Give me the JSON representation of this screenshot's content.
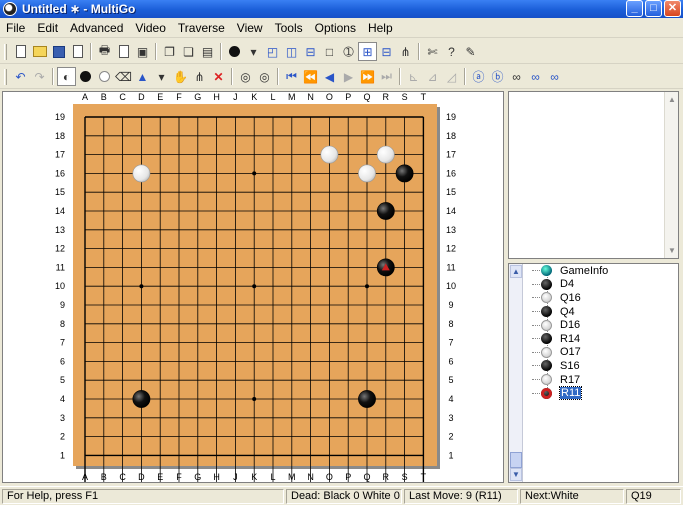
{
  "window": {
    "title": "Untitled  ∗ - MultiGo"
  },
  "menu": [
    "File",
    "Edit",
    "Advanced",
    "Video",
    "Traverse",
    "View",
    "Tools",
    "Options",
    "Help"
  ],
  "toolbar1": [
    "new-icon",
    "open-icon",
    "save-icon",
    "save-as-icon",
    "print-icon",
    "print-preview-icon",
    "export-image-icon",
    "copy-icon",
    "paste-icon",
    "properties-icon",
    "black-first-icon",
    "dropdown-icon",
    "board-view-1-icon",
    "board-view-2-icon",
    "board-view-3-icon",
    "board-view-4-icon",
    "move-number-icon",
    "tree-view-1-icon",
    "tree-view-2-icon",
    "tree-view-3-icon",
    "tools-icon",
    "help-icon",
    "brush-icon"
  ],
  "toolbar2": [
    "undo-icon",
    "redo-icon",
    "alternate-stones-icon",
    "black-stone-icon",
    "white-stone-icon",
    "eraser-icon",
    "marker-icon",
    "dropdown-icon",
    "hand-icon",
    "variation-icon",
    "delete-icon",
    "pass-black-icon",
    "pass-white-icon",
    "first-move-icon",
    "fast-back-icon",
    "back-icon",
    "forward-icon",
    "fast-forward-icon",
    "last-move-icon",
    "prev-variation-icon",
    "next-variation-icon",
    "nav-icon",
    "comment-1-icon",
    "comment-2-icon",
    "binoculars-1-icon",
    "binoculars-2-icon",
    "binoculars-3-icon"
  ],
  "board": {
    "size": 19,
    "columns": [
      "A",
      "B",
      "C",
      "D",
      "E",
      "F",
      "G",
      "H",
      "J",
      "K",
      "L",
      "M",
      "N",
      "O",
      "P",
      "Q",
      "R",
      "S",
      "T"
    ],
    "rows": [
      "19",
      "18",
      "17",
      "16",
      "15",
      "14",
      "13",
      "12",
      "11",
      "10",
      "9",
      "8",
      "7",
      "6",
      "5",
      "4",
      "3",
      "2",
      "1"
    ],
    "hoshi": [
      "D16",
      "K16",
      "Q16",
      "D10",
      "K10",
      "Q10",
      "D4",
      "K4",
      "Q4"
    ],
    "stones": [
      {
        "coord": "D4",
        "color": "black"
      },
      {
        "coord": "Q16",
        "color": "white"
      },
      {
        "coord": "Q4",
        "color": "black"
      },
      {
        "coord": "D16",
        "color": "white"
      },
      {
        "coord": "R14",
        "color": "black"
      },
      {
        "coord": "O17",
        "color": "white"
      },
      {
        "coord": "S16",
        "color": "black"
      },
      {
        "coord": "R17",
        "color": "white"
      },
      {
        "coord": "R11",
        "color": "black"
      }
    ],
    "last_move": "R11",
    "colors": {
      "board": "#e6a55b",
      "line": "#000000",
      "last_move_marker": "#cc2222"
    }
  },
  "tree": [
    {
      "label": "GameInfo",
      "kind": "game"
    },
    {
      "label": "D4",
      "kind": "black"
    },
    {
      "label": "Q16",
      "kind": "white"
    },
    {
      "label": "Q4",
      "kind": "black"
    },
    {
      "label": "D16",
      "kind": "white"
    },
    {
      "label": "R14",
      "kind": "black"
    },
    {
      "label": "O17",
      "kind": "white"
    },
    {
      "label": "S16",
      "kind": "black"
    },
    {
      "label": "R17",
      "kind": "white"
    },
    {
      "label": "R11",
      "kind": "current",
      "selected": true
    }
  ],
  "status": {
    "help": "For Help, press F1",
    "dead": "Dead: Black 0 White 0",
    "last_move": "Last Move: 9 (R11)",
    "next": "Next:White",
    "cursor": "Q19"
  }
}
